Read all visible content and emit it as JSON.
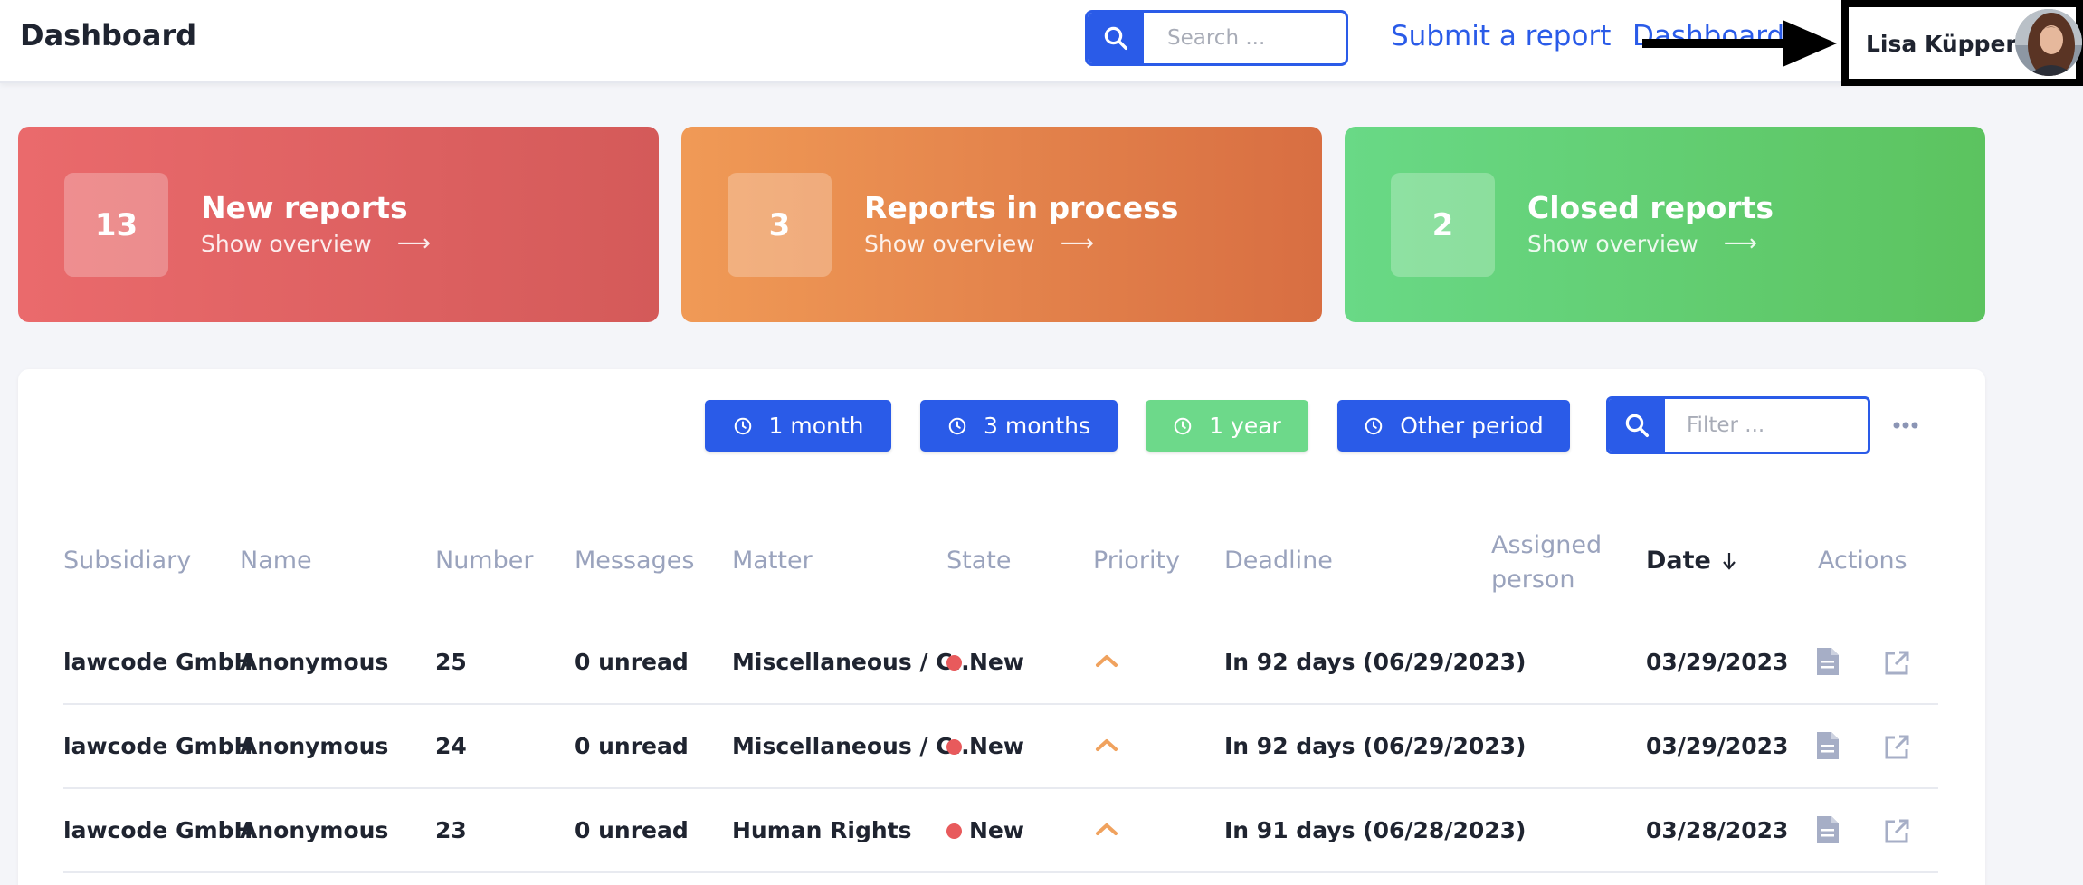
{
  "header": {
    "title": "Dashboard",
    "search_placeholder": "Search ...",
    "nav": {
      "submit_label": "Submit a report",
      "dashboard_label": "Dashboard"
    },
    "user": {
      "name": "Lisa Küppers"
    }
  },
  "cards": [
    {
      "count": "13",
      "title": "New reports",
      "link": "Show overview",
      "color": "#e0625f"
    },
    {
      "count": "3",
      "title": "Reports in process",
      "link": "Show overview",
      "color": "#e4854c"
    },
    {
      "count": "2",
      "title": "Closed reports",
      "link": "Show overview",
      "color": "#62cf72"
    }
  ],
  "filters": {
    "periods": [
      {
        "label": "1 month",
        "active": false
      },
      {
        "label": "3 months",
        "active": false
      },
      {
        "label": "1 year",
        "active": true
      },
      {
        "label": "Other period",
        "active": false
      }
    ],
    "filter_placeholder": "Filter ...",
    "more_icon": "ellipsis-icon"
  },
  "table": {
    "columns": [
      "Subsidiary",
      "Name",
      "Number",
      "Messages",
      "Matter",
      "State",
      "Priority",
      "Deadline",
      "Assigned person",
      "Date",
      "Actions"
    ],
    "sort_column": "Date",
    "rows": [
      {
        "subsidiary": "lawcode GmbH",
        "name": "Anonymous",
        "number": "25",
        "messages": "0 unread",
        "matter": "Miscellaneous / C...",
        "state": "New",
        "priority": "medium",
        "deadline": "In 92 days (06/29/2023)",
        "assigned": "",
        "date": "03/29/2023"
      },
      {
        "subsidiary": "lawcode GmbH",
        "name": "Anonymous",
        "number": "24",
        "messages": "0 unread",
        "matter": "Miscellaneous / C...",
        "state": "New",
        "priority": "medium",
        "deadline": "In 92 days (06/29/2023)",
        "assigned": "",
        "date": "03/29/2023"
      },
      {
        "subsidiary": "lawcode GmbH",
        "name": "Anonymous",
        "number": "23",
        "messages": "0 unread",
        "matter": "Human Rights",
        "state": "New",
        "priority": "medium",
        "deadline": "In 91 days (06/28/2023)",
        "assigned": "",
        "date": "03/28/2023"
      }
    ]
  },
  "colors": {
    "primary": "#2a5be8",
    "active_period": "#6dd98a",
    "state_new": "#e85a5c",
    "priority": "#f0a25e"
  }
}
